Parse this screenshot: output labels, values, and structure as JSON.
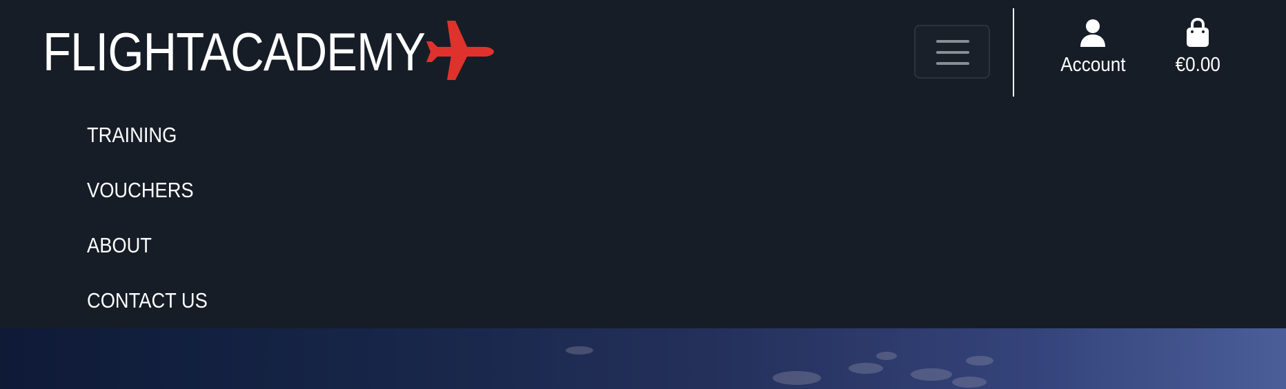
{
  "brand": {
    "name": "FLIGHTACADEMY",
    "accent_color": "#e0322d",
    "logo_icon": "airplane-icon"
  },
  "header": {
    "background": "#171d27",
    "toggle_icon": "hamburger-menu-icon",
    "account": {
      "label": "Account",
      "icon": "user-icon"
    },
    "cart": {
      "label": "€0.00",
      "icon": "shopping-bag-icon"
    }
  },
  "nav": {
    "items": [
      {
        "label": "TRAINING"
      },
      {
        "label": "VOUCHERS"
      },
      {
        "label": "ABOUT"
      },
      {
        "label": "CONTACT US"
      }
    ]
  }
}
